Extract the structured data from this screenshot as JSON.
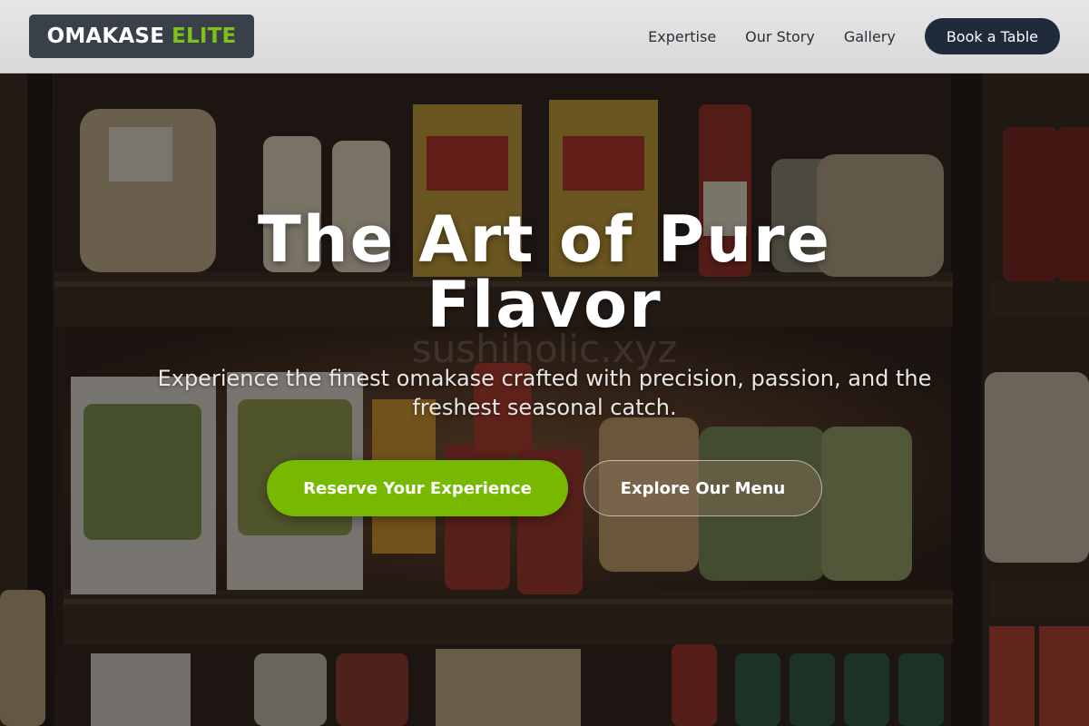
{
  "brand": {
    "name_part1": "OMAKASE",
    "name_part2": "ELITE"
  },
  "nav": {
    "links": [
      "Expertise",
      "Our Story",
      "Gallery"
    ],
    "cta_label": "Book a Table"
  },
  "hero": {
    "title": "The Art of Pure Flavor",
    "subtitle": "Experience the finest omakase crafted with precision, passion, and the freshest seasonal catch.",
    "primary_cta": "Reserve Your Experience",
    "secondary_cta": "Explore Our Menu",
    "watermark": "sushiholic.xyz"
  },
  "colors": {
    "accent_green": "#76b900",
    "navy": "#1f2a3b",
    "logo_bg": "#3a404a"
  },
  "background_image": "pantry shelves with pasta, jars and sauces"
}
